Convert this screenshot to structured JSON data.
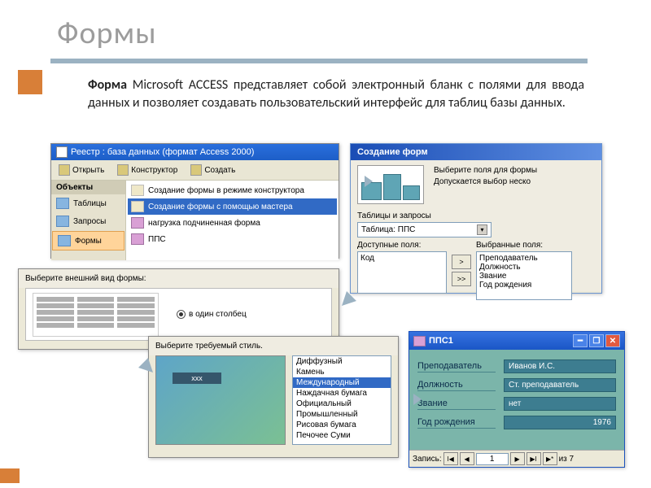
{
  "slide": {
    "title": "Формы"
  },
  "description": {
    "lead": "Форма ",
    "product": "Microsoft ACCESS ",
    "rest": "представляет собой электронный бланк с полями для ввода данных и позволяет создавать пользовательский интерфейс для таблиц базы данных."
  },
  "s1": {
    "window_title": "Реестр : база данных (формат Access 2000)",
    "toolbar": {
      "open": "Открыть",
      "design": "Конструктор",
      "create": "Создать"
    },
    "sidebar": {
      "header": "Объекты",
      "items": [
        "Таблицы",
        "Запросы",
        "Формы"
      ]
    },
    "list": {
      "items": [
        {
          "label": "Создание формы в режиме конструктора",
          "type": "wiz"
        },
        {
          "label": "Создание формы с помощью мастера",
          "type": "wiz",
          "selected": true
        },
        {
          "label": "нагрузка подчиненная форма",
          "type": "form"
        },
        {
          "label": "ППС",
          "type": "form"
        }
      ]
    }
  },
  "s2": {
    "title": "Создание форм",
    "prompt1": "Выберите поля для формы",
    "prompt2": "Допускается выбор неско",
    "tables_label": "Таблицы и запросы",
    "combo_value": "Таблица: ППС",
    "available_label": "Доступные поля:",
    "selected_label": "Выбранные поля:",
    "available": [
      "Код"
    ],
    "selected": [
      "Преподаватель",
      "Должность",
      "Звание",
      "Год рождения"
    ],
    "btn1": ">",
    "btn2": ">>"
  },
  "s3": {
    "label": "Выберите внешний вид формы:",
    "option": "в один столбец"
  },
  "s4": {
    "label": "Выберите требуемый стиль.",
    "preview_caption": "xxx",
    "styles": [
      "Диффузный",
      "Камень",
      "Международный",
      "Наждачная бумага",
      "Официальный",
      "Промышленный",
      "Рисовая бумага",
      "Печочее Суми"
    ],
    "selected_index": 2
  },
  "s5": {
    "title": "ППС1",
    "fields": [
      {
        "label": "Преподаватель",
        "value": "Иванов И.С."
      },
      {
        "label": "Должность",
        "value": "Ст. преподаватель"
      },
      {
        "label": "Звание",
        "value": "нет"
      },
      {
        "label": "Год рождения",
        "value": "1976"
      }
    ],
    "nav": {
      "label": "Запись:",
      "current": "1",
      "of": "из  7"
    }
  }
}
